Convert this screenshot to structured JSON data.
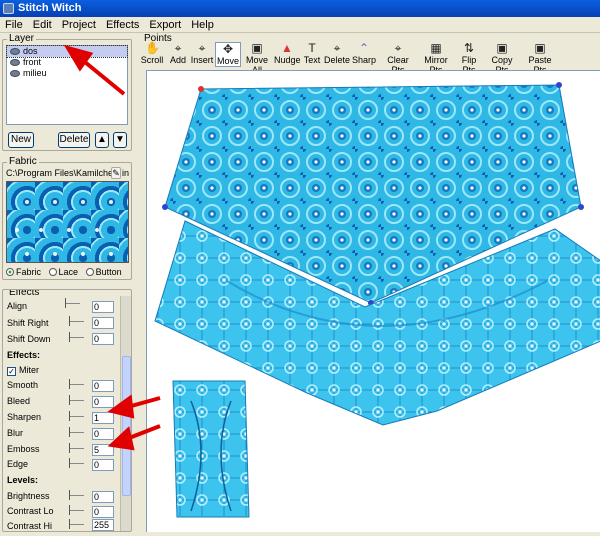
{
  "window": {
    "title": "Stitch Witch"
  },
  "menu": [
    "File",
    "Edit",
    "Project",
    "Effects",
    "Export",
    "Help"
  ],
  "layer": {
    "label": "Layer",
    "items": [
      {
        "name": "dos",
        "selected": true
      },
      {
        "name": "front",
        "selected": false
      },
      {
        "name": "milieu",
        "selected": false
      }
    ],
    "new_label": "New",
    "delete_label": "Delete",
    "up_icon": "arrow-up-icon",
    "down_icon": "arrow-down-icon"
  },
  "fabric": {
    "label": "Fabric",
    "path": "C:\\Program Files\\Kamilche Co",
    "path_tail": "in",
    "options": [
      "Fabric",
      "Lace",
      "Button"
    ],
    "selected": "Fabric"
  },
  "effects": {
    "label": "Effects",
    "align_label": "Align",
    "shift_right_label": "Shift Right",
    "shift_right_value": "0",
    "shift_down_label": "Shift Down",
    "shift_down_value": "0",
    "align_value": "0",
    "section_effects": "Effects:",
    "miter_label": "Miter",
    "miter_checked": true,
    "smooth_label": "Smooth",
    "smooth_value": "0",
    "bleed_label": "Bleed",
    "bleed_value": "0",
    "sharpen_label": "Sharpen",
    "sharpen_value": "1",
    "blur_label": "Blur",
    "blur_value": "0",
    "emboss_label": "Emboss",
    "emboss_value": "5",
    "edge_label": "Edge",
    "edge_value": "0",
    "section_levels": "Levels:",
    "brightness_label": "Brightness",
    "brightness_value": "0",
    "contrast_lo_label": "Contrast Lo",
    "contrast_lo_value": "0",
    "contrast_hi_label": "Contrast Hi",
    "contrast_hi_value": "255"
  },
  "points": {
    "label": "Points",
    "tools": [
      {
        "label": "Scroll",
        "icon": "hand-icon"
      },
      {
        "label": "Add",
        "icon": "add-point-icon"
      },
      {
        "label": "Insert",
        "icon": "insert-point-icon"
      },
      {
        "label": "Move",
        "icon": "move-icon"
      },
      {
        "label": "Move All",
        "icon": "move-all-icon"
      },
      {
        "label": "Nudge",
        "icon": "nudge-icon"
      },
      {
        "label": "Text",
        "icon": "text-icon"
      },
      {
        "label": "Delete",
        "icon": "delete-point-icon"
      },
      {
        "label": "Sharp",
        "icon": "sharp-icon"
      },
      {
        "label": "Clear Pts",
        "icon": "clear-points-icon"
      },
      {
        "label": "Mirror Pts",
        "icon": "mirror-points-icon"
      },
      {
        "label": "Flip Pts",
        "icon": "flip-points-icon"
      },
      {
        "label": "Copy Pts",
        "icon": "copy-points-icon"
      },
      {
        "label": "Paste Pts",
        "icon": "paste-points-icon"
      }
    ]
  },
  "colors": {
    "title_bar": "#0a50d0",
    "fabric_blue": "#2fb7e6",
    "annotation_red": "#e00000"
  }
}
